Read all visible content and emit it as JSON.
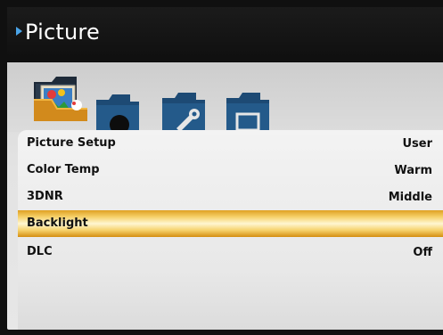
{
  "header": {
    "title": "Picture"
  },
  "tabs": [
    {
      "icon": "picture-folder-icon",
      "active": true
    },
    {
      "icon": "sound-folder-icon",
      "active": false
    },
    {
      "icon": "setup-folder-icon",
      "active": false
    },
    {
      "icon": "screen-folder-icon",
      "active": false
    }
  ],
  "menu": {
    "items": [
      {
        "label": "Picture Setup",
        "value": "User"
      },
      {
        "label": "Color Temp",
        "value": "Warm"
      },
      {
        "label": "3DNR",
        "value": "Middle"
      },
      {
        "label": "Backlight",
        "value": ""
      },
      {
        "label": "DLC",
        "value": "Off"
      }
    ],
    "selected_index": 3
  },
  "colors": {
    "header_bg": "#141414",
    "accent_arrow": "#4aa4e8",
    "folder_blue": "#1f4f7a",
    "highlight": "#f4c54a"
  }
}
